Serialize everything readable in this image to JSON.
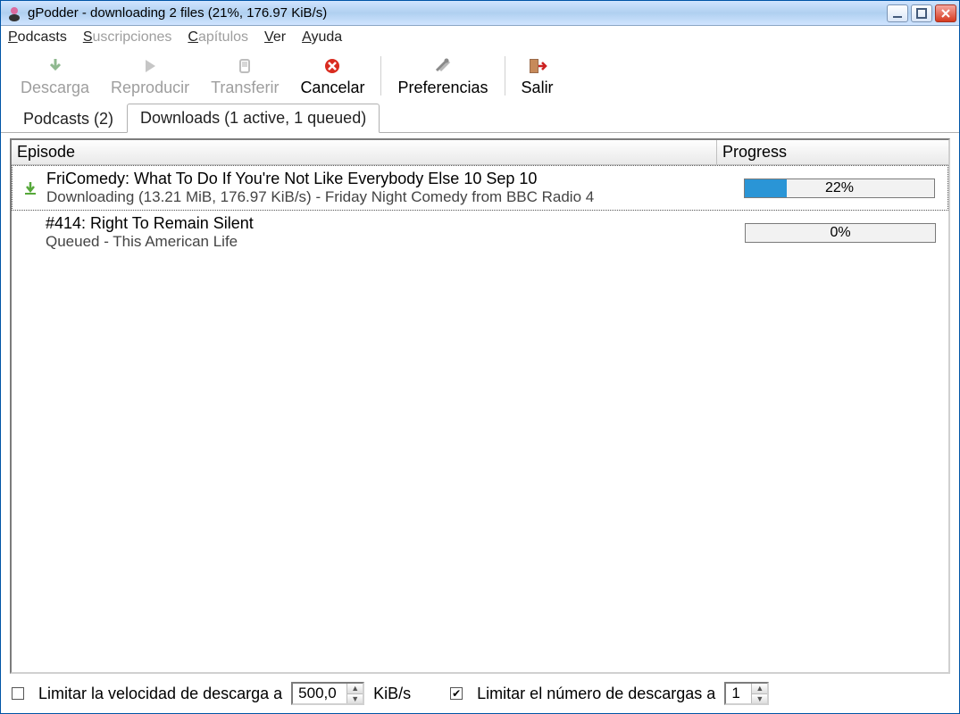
{
  "titlebar": {
    "title": "gPodder - downloading 2 files (21%, 176.97 KiB/s)"
  },
  "menu": {
    "podcasts": "Podcasts",
    "suscripciones": "Suscripciones",
    "capitulos": "Capítulos",
    "ver": "Ver",
    "ayuda": "Ayuda"
  },
  "toolbar": {
    "descarga": "Descarga",
    "reproducir": "Reproducir",
    "transferir": "Transferir",
    "cancelar": "Cancelar",
    "preferencias": "Preferencias",
    "salir": "Salir"
  },
  "tabs": {
    "podcasts": "Podcasts (2)",
    "downloads": "Downloads (1 active, 1 queued)"
  },
  "columns": {
    "episode": "Episode",
    "progress": "Progress"
  },
  "downloads": [
    {
      "title": "FriComedy: What To Do If You're Not Like Everybody Else  10 Sep 10",
      "subtitle": "Downloading (13.21 MiB, 176.97 KiB/s) - Friday Night Comedy from BBC Radio 4",
      "progress_pct": 22,
      "progress_label": "22%",
      "icon": "download",
      "selected": true
    },
    {
      "title": "#414: Right To Remain Silent",
      "subtitle": "Queued - This American Life",
      "progress_pct": 0,
      "progress_label": "0%",
      "icon": "",
      "selected": false
    }
  ],
  "bottom": {
    "limit_speed_label": "Limitar la velocidad de descarga a",
    "limit_speed_checked": false,
    "limit_speed_value": "500,0",
    "limit_speed_unit": "KiB/s",
    "limit_count_label": "Limitar el número de descargas a",
    "limit_count_checked": true,
    "limit_count_value": "1"
  }
}
